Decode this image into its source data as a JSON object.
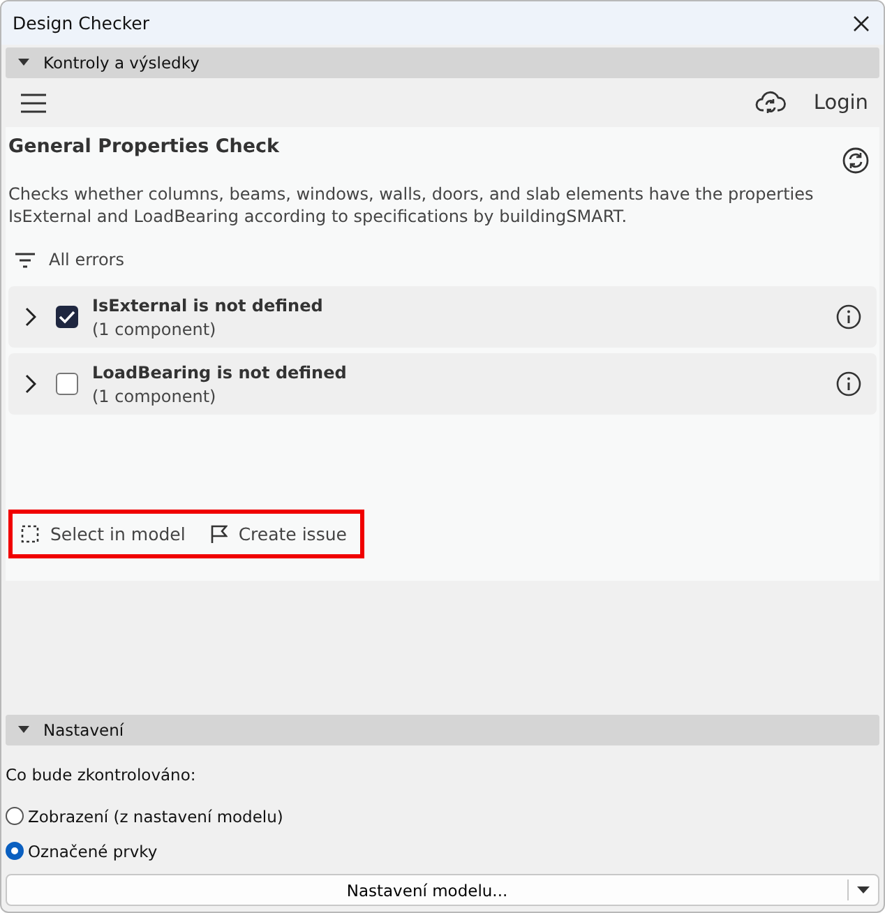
{
  "window": {
    "title": "Design Checker"
  },
  "results_section": {
    "title": "Kontroly a výsledky",
    "expanded": true
  },
  "toolbar": {
    "login": "Login"
  },
  "check": {
    "title": "General Properties Check",
    "description": "Checks whether columns, beams, windows, walls, doors, and slab elements have the properties IsExternal and LoadBearing according to specifications by buildingSMART.",
    "filter": "All errors",
    "errors": [
      {
        "title": "IsExternal is not defined",
        "count": "(1 component)",
        "checked": true
      },
      {
        "title": "LoadBearing is not defined",
        "count": "(1 component)",
        "checked": false
      }
    ]
  },
  "actions": {
    "highlighted": true,
    "items": [
      {
        "kind": "select",
        "label": "Select in model"
      },
      {
        "kind": "issue",
        "label": "Create issue"
      }
    ]
  },
  "settings_section": {
    "title": "Nastavení",
    "expanded": true,
    "question": "Co bude zkontrolováno:",
    "options": [
      {
        "label": "Zobrazení (z nastavení modelu)",
        "selected": false
      },
      {
        "label": "Označené prvky",
        "selected": true
      }
    ],
    "button": "Nastavení modelu..."
  }
}
